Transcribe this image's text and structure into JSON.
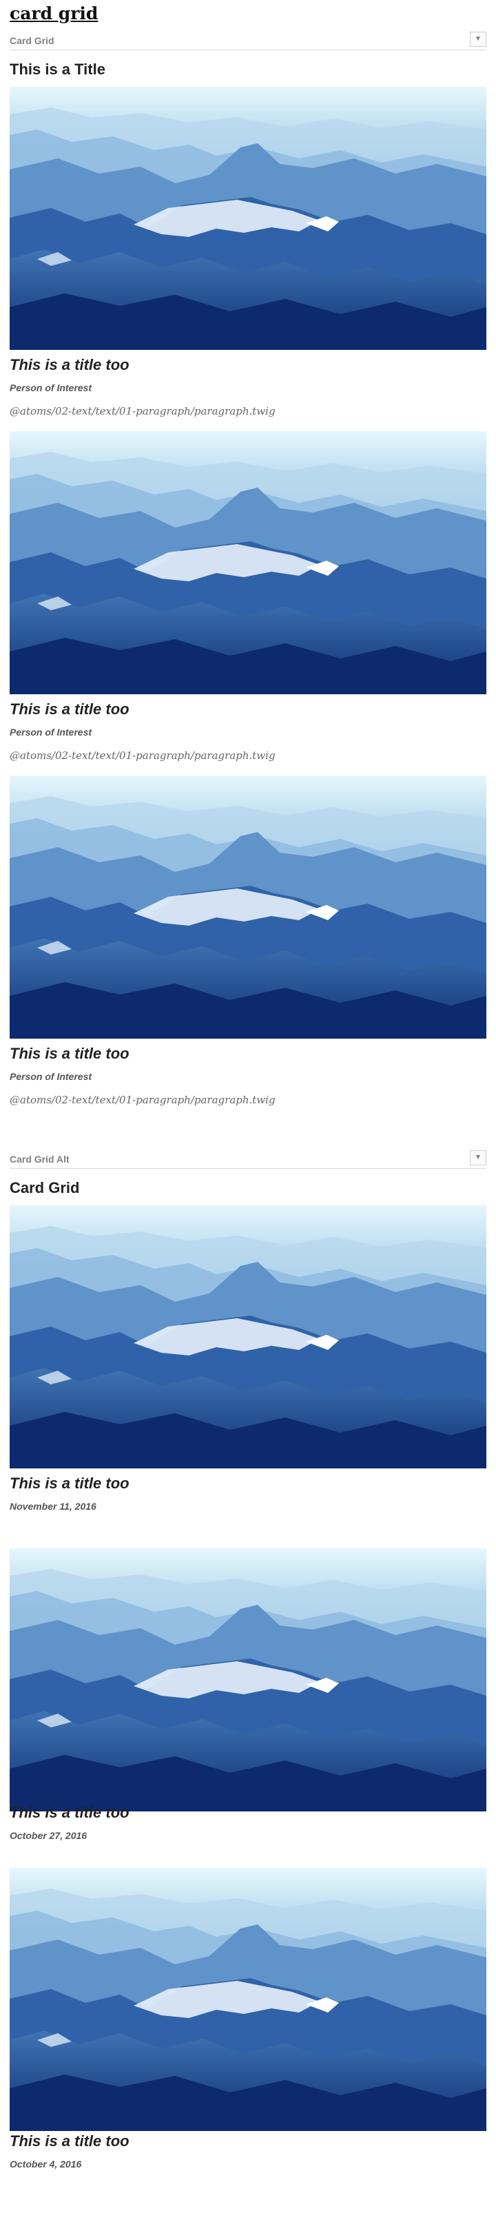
{
  "page": {
    "title": "card grid"
  },
  "pattern_1": {
    "label": "Card Grid",
    "toggle_icon": "▼",
    "section_title": "This is a Title",
    "cards": [
      {
        "image_alt": "Aerial view of snow-capped blue mountain range",
        "title": "This is a title too",
        "subtitle": "Person of Interest",
        "paragraph": "@atoms/02-text/text/01-paragraph/paragraph.twig"
      },
      {
        "image_alt": "Aerial view of snow-capped blue mountain range",
        "title": "This is a title too",
        "subtitle": "Person of Interest",
        "paragraph": "@atoms/02-text/text/01-paragraph/paragraph.twig"
      },
      {
        "image_alt": "Aerial view of snow-capped blue mountain range",
        "title": "This is a title too",
        "subtitle": "Person of Interest",
        "paragraph": "@atoms/02-text/text/01-paragraph/paragraph.twig"
      }
    ]
  },
  "pattern_2": {
    "label": "Card Grid Alt",
    "toggle_icon": "▼",
    "section_title": "Card Grid",
    "cards": [
      {
        "image_alt": "Aerial view of snow-capped blue mountain range",
        "title": "This is a title too",
        "date": "November 11, 2016"
      },
      {
        "image_alt": "Aerial view of snow-capped blue mountain range",
        "title": "This is a title too",
        "date": "October 27, 2016"
      },
      {
        "image_alt": "Aerial view of snow-capped blue mountain range",
        "title": "This is a title too",
        "date": "October 4, 2016"
      }
    ]
  },
  "colors": {
    "sky_top": "#e4f5fb",
    "mountain_dark": "#0d2f78",
    "snow": "#f2f8ff"
  }
}
